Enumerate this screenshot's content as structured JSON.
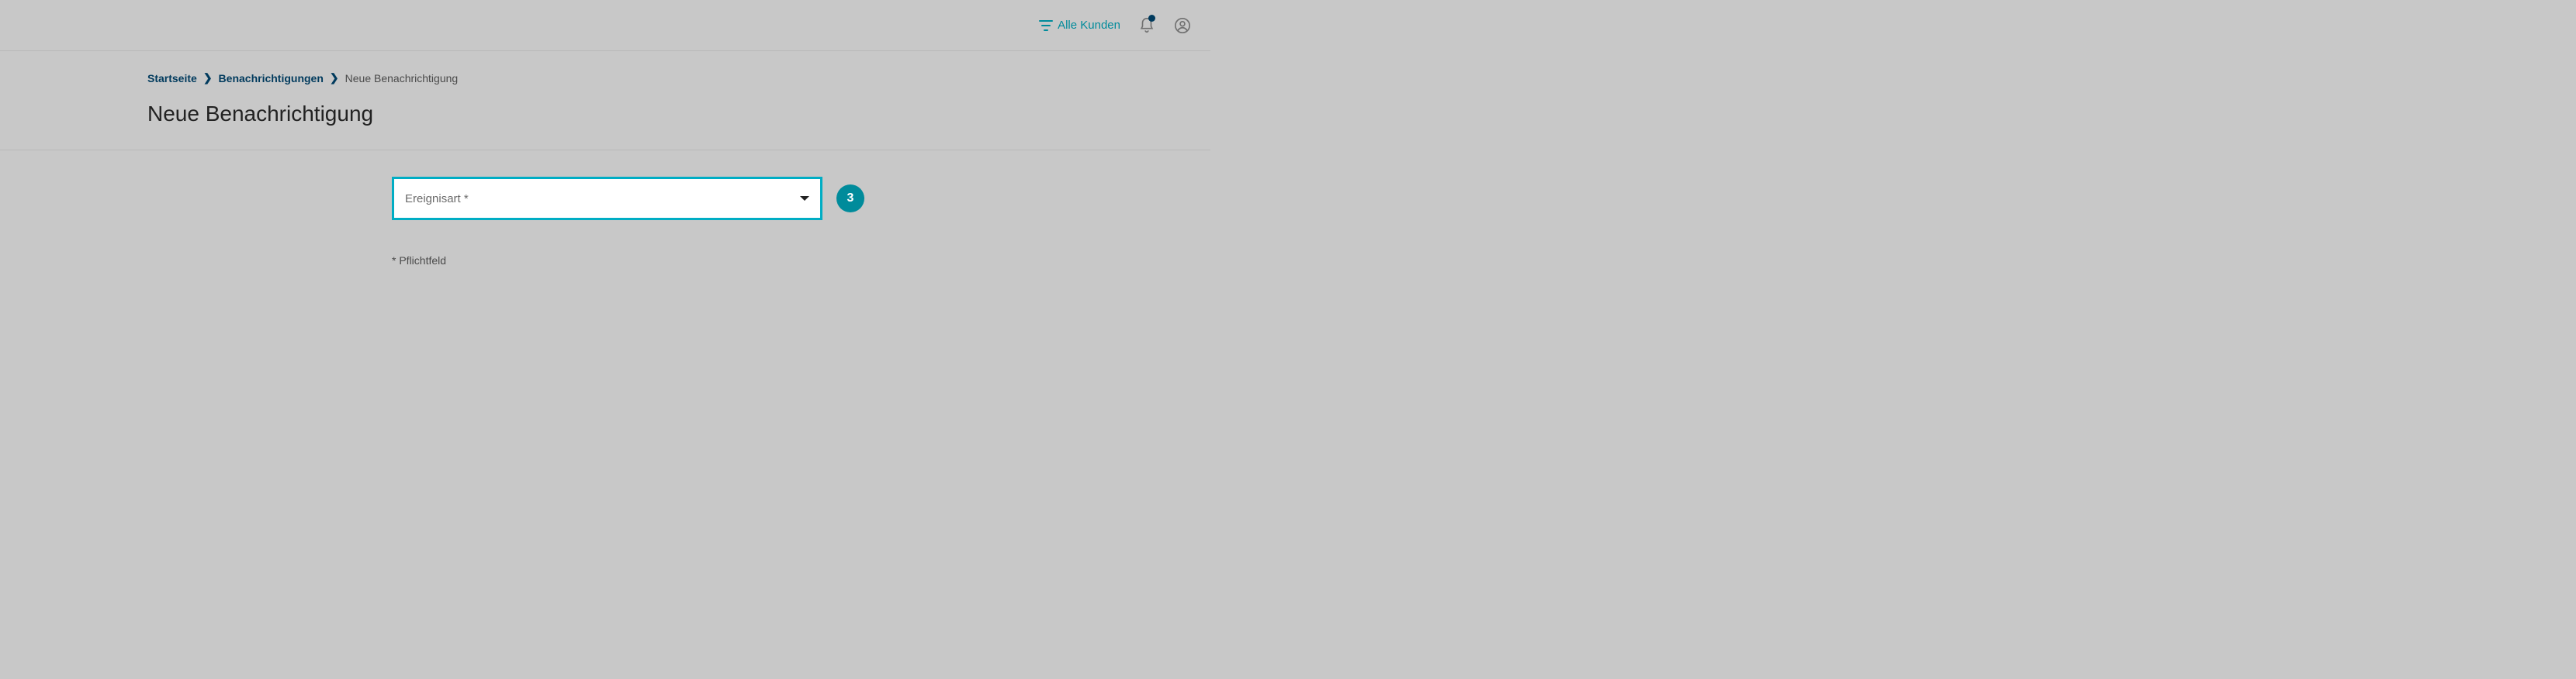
{
  "topbar": {
    "filter_label": "Alle Kunden"
  },
  "breadcrumb": {
    "home": "Startseite",
    "section": "Benachrichtigungen",
    "current": "Neue Benachrichtigung"
  },
  "page": {
    "title": "Neue Benachrichtigung"
  },
  "form": {
    "event_type_label": "Ereignisart *",
    "badge": "3",
    "required_hint": "* Pflichtfeld"
  }
}
